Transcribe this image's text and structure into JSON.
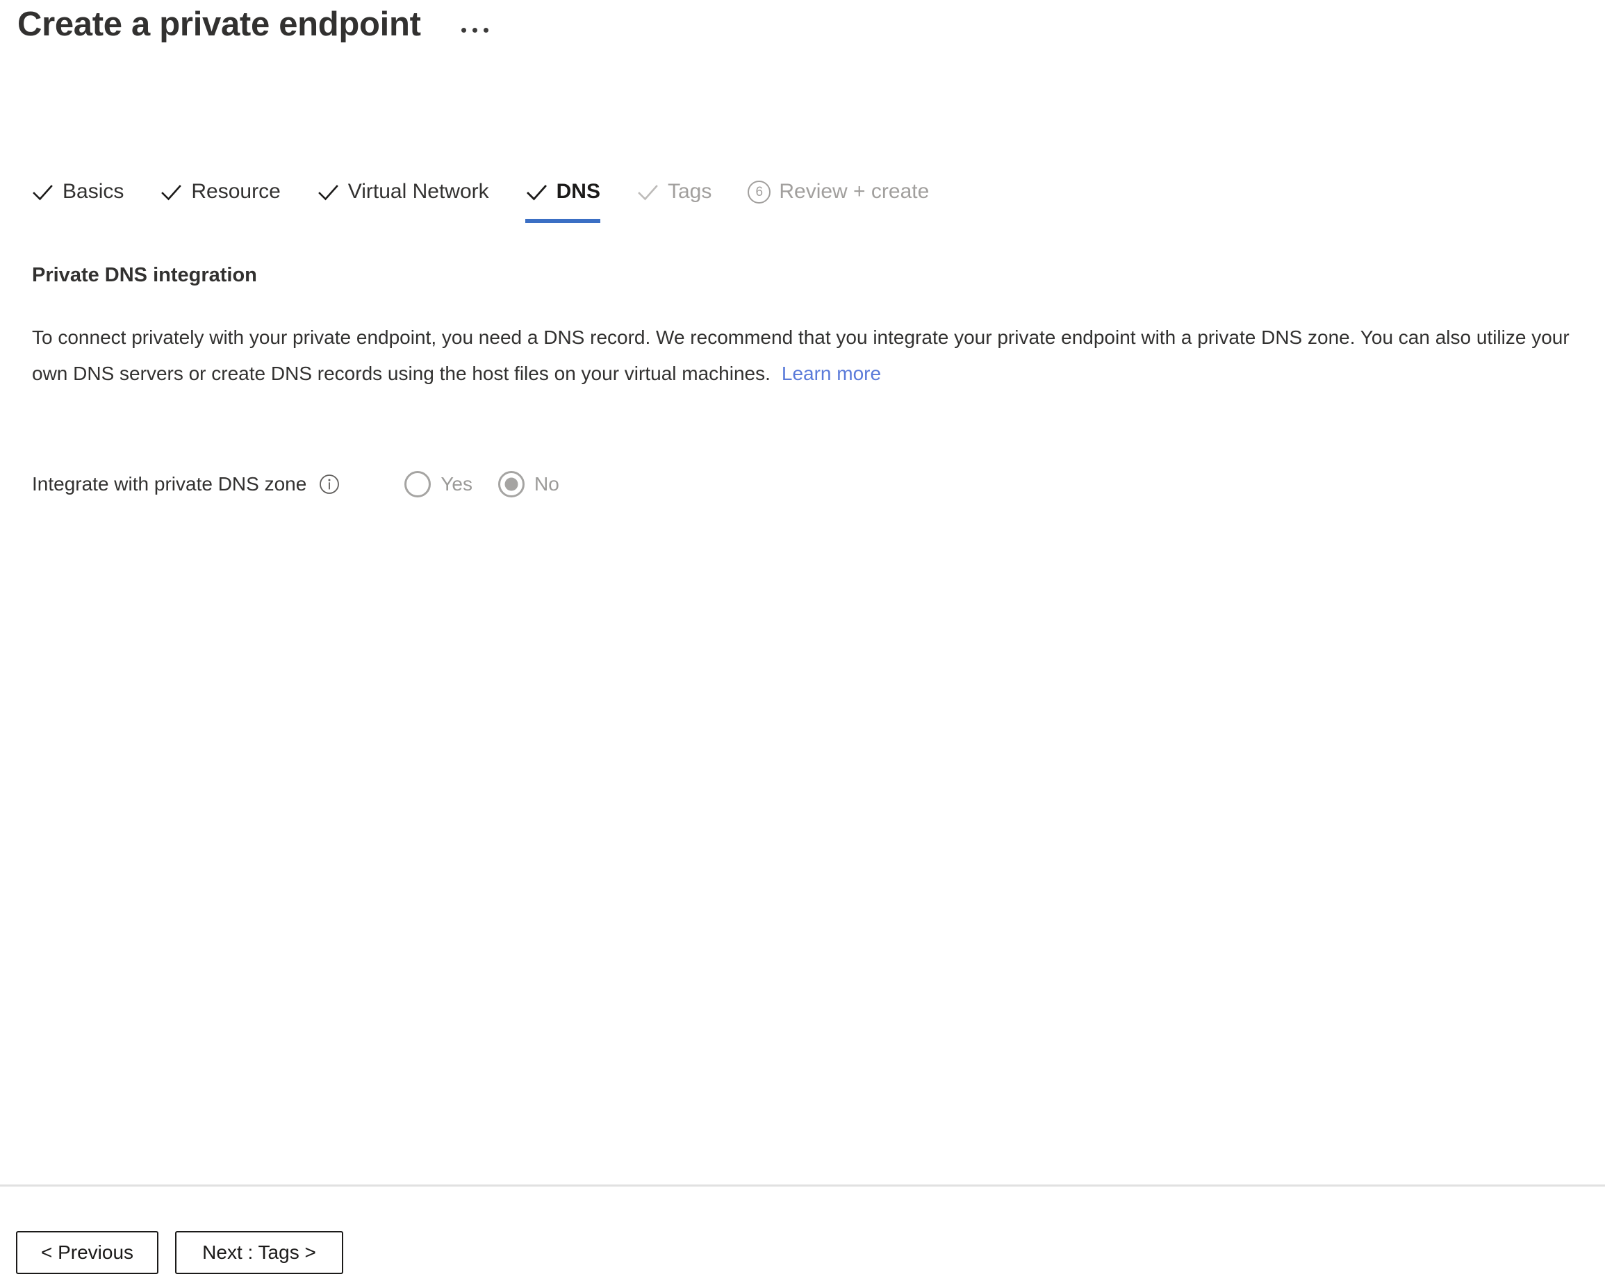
{
  "header": {
    "title": "Create a private endpoint",
    "more_menu_icon": "ellipsis-horizontal-icon"
  },
  "tabs": [
    {
      "label": "Basics",
      "state": "completed",
      "icon": "check-icon"
    },
    {
      "label": "Resource",
      "state": "completed",
      "icon": "check-icon"
    },
    {
      "label": "Virtual Network",
      "state": "completed",
      "icon": "check-icon"
    },
    {
      "label": "DNS",
      "state": "active",
      "icon": "check-icon"
    },
    {
      "label": "Tags",
      "state": "disabled",
      "icon": "check-icon"
    },
    {
      "label": "Review + create",
      "state": "disabled",
      "icon": "number-badge",
      "number": "6"
    }
  ],
  "section": {
    "heading": "Private DNS integration",
    "description": "To connect privately with your private endpoint, you need a DNS record. We recommend that you integrate your private endpoint with a private DNS zone. You can also utilize your own DNS servers or create DNS records using the host files on your virtual machines.",
    "learn_more_label": "Learn more"
  },
  "field": {
    "label": "Integrate with private DNS zone",
    "info_icon": "info-circle-icon",
    "options": [
      {
        "label": "Yes",
        "selected": false
      },
      {
        "label": "No",
        "selected": true
      }
    ]
  },
  "footer": {
    "previous_label": "< Previous",
    "next_label": "Next : Tags >"
  },
  "colors": {
    "accent_underline": "#3b6fc4",
    "link": "#5a7ad9",
    "disabled_text": "#a19f9d",
    "body_text": "#323130",
    "divider": "#e1e1e1"
  }
}
